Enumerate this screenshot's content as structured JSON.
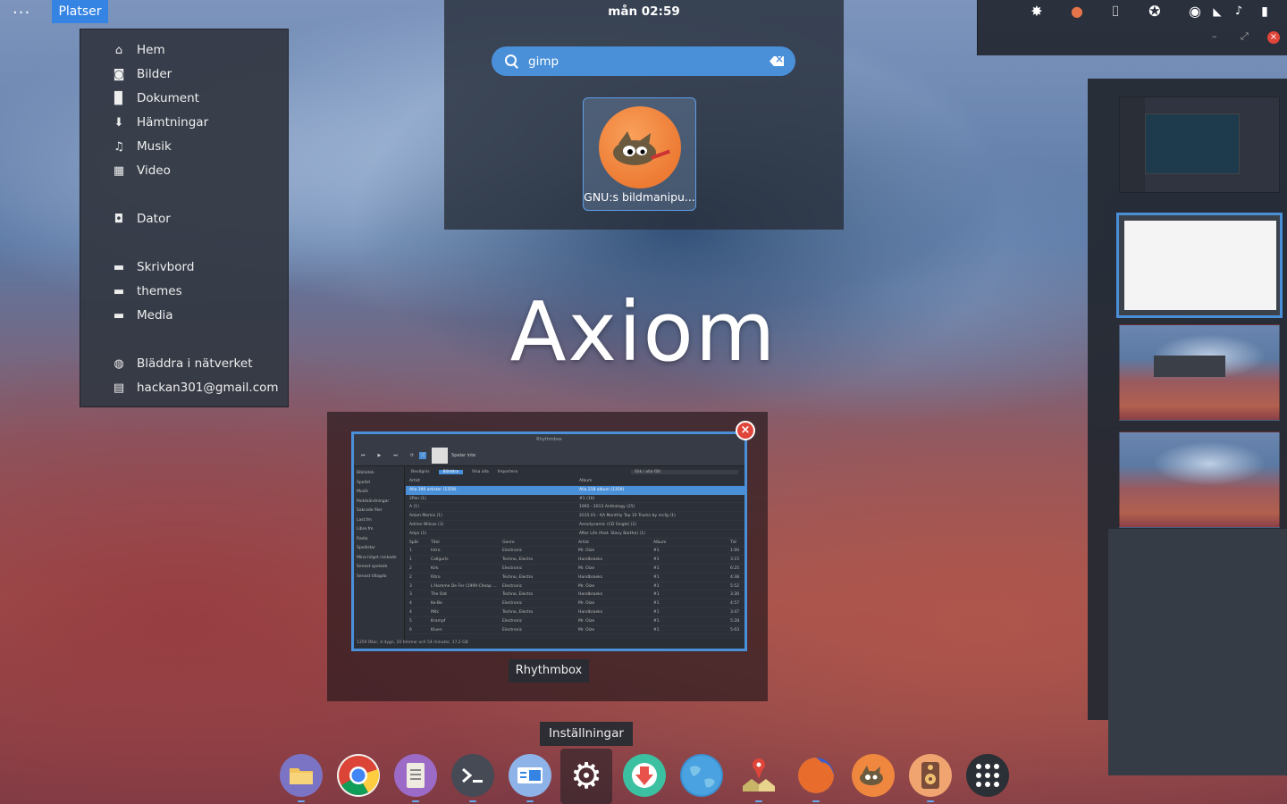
{
  "topbar": {
    "menu_glyph": "···",
    "places_button": "Platser"
  },
  "places": [
    {
      "label": "Hem",
      "icon": "home-icon",
      "glyph": "⌂"
    },
    {
      "label": "Bilder",
      "icon": "camera-icon",
      "glyph": "◙"
    },
    {
      "label": "Dokument",
      "icon": "document-icon",
      "glyph": "▉"
    },
    {
      "label": "Hämtningar",
      "icon": "download-icon",
      "glyph": "⬇"
    },
    {
      "label": "Musik",
      "icon": "music-icon",
      "glyph": "♫"
    },
    {
      "label": "Video",
      "icon": "film-icon",
      "glyph": "▦"
    },
    {
      "label": "Dator",
      "icon": "computer-icon",
      "glyph": "◘"
    },
    {
      "label": "Skrivbord",
      "icon": "folder-icon",
      "glyph": "▬"
    },
    {
      "label": "themes",
      "icon": "folder-icon",
      "glyph": "▬"
    },
    {
      "label": "Media",
      "icon": "folder-icon",
      "glyph": "▬"
    },
    {
      "label": "Bläddra i nätverket",
      "icon": "network-icon",
      "glyph": "◍"
    },
    {
      "label": "hackan301@gmail.com",
      "icon": "server-icon",
      "glyph": "▤"
    }
  ],
  "clock": "mån 02:59",
  "search": {
    "value": "gimp"
  },
  "result": {
    "label": "GNU:s bildmanipu..."
  },
  "tray": [
    {
      "name": "weather-settings-icon",
      "glyph": "✸"
    },
    {
      "name": "balloon-icon",
      "glyph": "●"
    },
    {
      "name": "camera-icon",
      "glyph": "⌷"
    },
    {
      "name": "accessibility-icon",
      "glyph": "✪"
    },
    {
      "name": "record-icon",
      "glyph": "◉"
    },
    {
      "name": "wifi-icon",
      "glyph": "◣"
    },
    {
      "name": "volume-icon",
      "glyph": "♪"
    },
    {
      "name": "battery-icon",
      "glyph": "▮"
    }
  ],
  "window_controls": {
    "minimize": "–",
    "maximize": "⤢",
    "close": "×"
  },
  "title": "Axiom",
  "rhythmbox": {
    "window_title": "Rhythmbox",
    "now_playing": "Spelar inte",
    "tabs": [
      "Bevägnis",
      "Bläddra",
      "Visa alla",
      "Importera"
    ],
    "search_placeholder": "Sök i alla fält",
    "sidebar": [
      "Bibliotek",
      "Spellst",
      "Musik",
      "Poddsändningar",
      "Sakrade filer",
      "Radio",
      "Last.fm",
      "Libre.fm",
      "Radio",
      "Spellistor",
      "Mina högst rankade",
      "Senast spelade",
      "Senast tillagda"
    ],
    "browser_headers": [
      "Artist",
      "Album"
    ],
    "artists": [
      "Alla 390 artister (1359)",
      "2Pan (1)",
      "A (1)",
      "Adam Markis (1)",
      "Adrien Wilcox (1)",
      "Adyo (1)"
    ],
    "albums": [
      "Alla 218 album (1359)",
      "#1 (10)",
      "1992 - 2013 Anthology (25)",
      "2015.01 - KA Monthly Top 10 Tracks by mcfg (1)",
      "Aerodynamic (CD Single) (2)",
      "After Life (feat. Stacy Barthe) (1)"
    ],
    "track_headers": [
      "Spår",
      "Titel",
      "Genre",
      "Artist",
      "Album",
      "Tid"
    ],
    "tracks": [
      [
        "1",
        "Intro",
        "Electronic",
        "Mr. Oize",
        "#1",
        "1:00"
      ],
      [
        "1",
        "Callgurls",
        "Techno, Electro",
        "Handbraeks",
        "#1",
        "3:15"
      ],
      [
        "2",
        "Kirk",
        "Electronic",
        "Mr. Oize",
        "#1",
        "6:25"
      ],
      [
        "2",
        "Ritro",
        "Techno, Electro",
        "Handbraeks",
        "#1",
        "4:38"
      ],
      [
        "3",
        "L'Homme De Fer (1999 Cheap ...",
        "Electronic",
        "Mr. Oize",
        "#1",
        "5:52"
      ],
      [
        "3",
        "The Oat",
        "Techno, Electro",
        "Handbraeks",
        "#1",
        "3:30"
      ],
      [
        "4",
        "Ke-Be",
        "Electronic",
        "Mr. Oize",
        "#1",
        "4:57"
      ],
      [
        "4",
        "Mitc",
        "Techno, Electro",
        "Handbraeks",
        "#1",
        "3:47"
      ],
      [
        "5",
        "Krampf",
        "Electronic",
        "Mr. Oize",
        "#1",
        "5:28"
      ],
      [
        "6",
        "Kluen",
        "Electronic",
        "Mr. Oize",
        "#1",
        "5:03"
      ]
    ],
    "status": "1359 låtar, 4 dygn, 20 timmar och 54 minuter, 17,2 GB"
  },
  "window_caption": "Rhythmbox",
  "close_glyph": "×",
  "tooltip": "Inställningar",
  "dock": [
    {
      "name": "files-icon",
      "color": "#7b74c4"
    },
    {
      "name": "chrome-icon",
      "color": "#f2f2f2"
    },
    {
      "name": "text-editor-icon",
      "color": "#9c6bc7"
    },
    {
      "name": "terminal-icon",
      "color": "#454a55"
    },
    {
      "name": "software-center-icon",
      "color": "#6b9ee4"
    },
    {
      "name": "settings-icon",
      "color": "#3b3f47"
    },
    {
      "name": "software-update-icon",
      "color": "#3cc0a2"
    },
    {
      "name": "web-browser-icon",
      "color": "#3b8fd0"
    },
    {
      "name": "maps-icon",
      "color": "#e8d48c"
    },
    {
      "name": "firefox-icon",
      "color": "#e86c2b"
    },
    {
      "name": "gimp-icon",
      "color": "#f0873f"
    },
    {
      "name": "rhythmbox-icon",
      "color": "#f0a470"
    },
    {
      "name": "app-grid-icon",
      "color": "#2b2f36"
    }
  ]
}
